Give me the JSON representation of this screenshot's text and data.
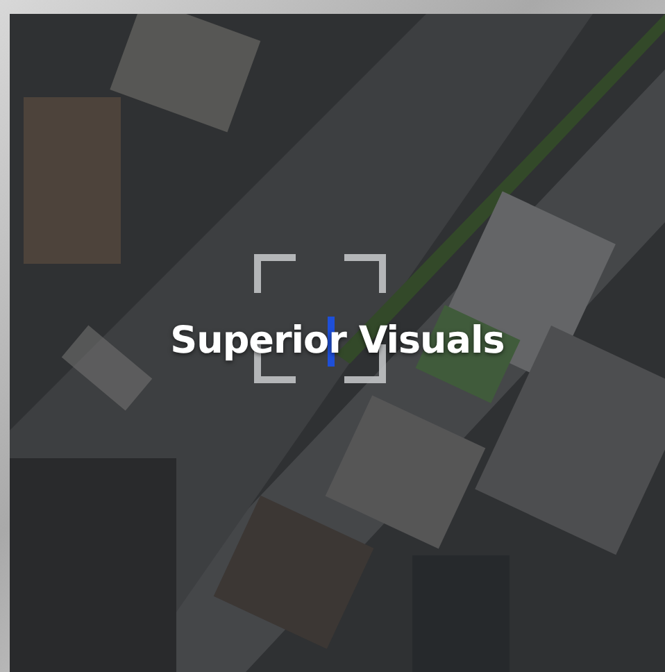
{
  "title": "Superior Visuals"
}
